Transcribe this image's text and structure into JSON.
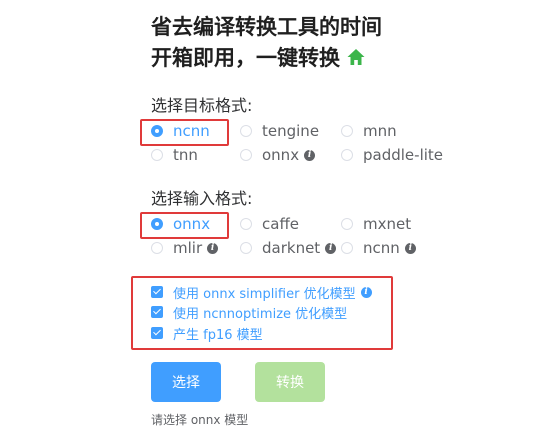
{
  "header": {
    "title_line1": "省去编译转换工具的时间",
    "title_line2": "开箱即用，一键转换",
    "home_icon": "home-icon",
    "home_icon_color": "#3bb54a"
  },
  "target_format": {
    "label": "选择目标格式:",
    "options": [
      "ncnn",
      "tengine",
      "mnn",
      "tnn",
      "onnx",
      "paddle-lite"
    ],
    "selected": "ncnn"
  },
  "input_format": {
    "label": "选择输入格式:",
    "options": [
      "onnx",
      "caffe",
      "mxnet",
      "mlir",
      "darknet",
      "ncnn"
    ],
    "selected": "onnx"
  },
  "checkboxes": [
    {
      "label": "使用 onnx simplifier 优化模型",
      "checked": true
    },
    {
      "label": "使用 ncnnoptimize 优化模型",
      "checked": true
    },
    {
      "label": "产生 fp16 模型",
      "checked": true
    }
  ],
  "buttons": {
    "select_label": "选择",
    "convert_label": "转换"
  },
  "status": {
    "hint": "请选择 onnx 模型"
  },
  "colors": {
    "accent": "#409eff",
    "highlight_box": "#e03a3a",
    "disabled_button": "#b3e19d"
  }
}
